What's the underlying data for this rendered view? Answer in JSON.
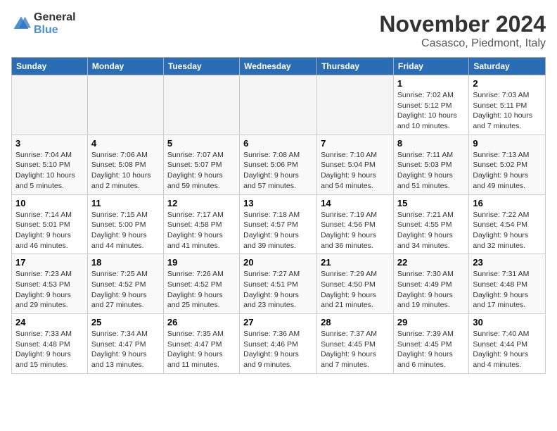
{
  "logo": {
    "text_general": "General",
    "text_blue": "Blue"
  },
  "header": {
    "month": "November 2024",
    "location": "Casasco, Piedmont, Italy"
  },
  "weekdays": [
    "Sunday",
    "Monday",
    "Tuesday",
    "Wednesday",
    "Thursday",
    "Friday",
    "Saturday"
  ],
  "weeks": [
    [
      {
        "day": "",
        "info": ""
      },
      {
        "day": "",
        "info": ""
      },
      {
        "day": "",
        "info": ""
      },
      {
        "day": "",
        "info": ""
      },
      {
        "day": "",
        "info": ""
      },
      {
        "day": "1",
        "info": "Sunrise: 7:02 AM\nSunset: 5:12 PM\nDaylight: 10 hours and 10 minutes."
      },
      {
        "day": "2",
        "info": "Sunrise: 7:03 AM\nSunset: 5:11 PM\nDaylight: 10 hours and 7 minutes."
      }
    ],
    [
      {
        "day": "3",
        "info": "Sunrise: 7:04 AM\nSunset: 5:10 PM\nDaylight: 10 hours and 5 minutes."
      },
      {
        "day": "4",
        "info": "Sunrise: 7:06 AM\nSunset: 5:08 PM\nDaylight: 10 hours and 2 minutes."
      },
      {
        "day": "5",
        "info": "Sunrise: 7:07 AM\nSunset: 5:07 PM\nDaylight: 9 hours and 59 minutes."
      },
      {
        "day": "6",
        "info": "Sunrise: 7:08 AM\nSunset: 5:06 PM\nDaylight: 9 hours and 57 minutes."
      },
      {
        "day": "7",
        "info": "Sunrise: 7:10 AM\nSunset: 5:04 PM\nDaylight: 9 hours and 54 minutes."
      },
      {
        "day": "8",
        "info": "Sunrise: 7:11 AM\nSunset: 5:03 PM\nDaylight: 9 hours and 51 minutes."
      },
      {
        "day": "9",
        "info": "Sunrise: 7:13 AM\nSunset: 5:02 PM\nDaylight: 9 hours and 49 minutes."
      }
    ],
    [
      {
        "day": "10",
        "info": "Sunrise: 7:14 AM\nSunset: 5:01 PM\nDaylight: 9 hours and 46 minutes."
      },
      {
        "day": "11",
        "info": "Sunrise: 7:15 AM\nSunset: 5:00 PM\nDaylight: 9 hours and 44 minutes."
      },
      {
        "day": "12",
        "info": "Sunrise: 7:17 AM\nSunset: 4:58 PM\nDaylight: 9 hours and 41 minutes."
      },
      {
        "day": "13",
        "info": "Sunrise: 7:18 AM\nSunset: 4:57 PM\nDaylight: 9 hours and 39 minutes."
      },
      {
        "day": "14",
        "info": "Sunrise: 7:19 AM\nSunset: 4:56 PM\nDaylight: 9 hours and 36 minutes."
      },
      {
        "day": "15",
        "info": "Sunrise: 7:21 AM\nSunset: 4:55 PM\nDaylight: 9 hours and 34 minutes."
      },
      {
        "day": "16",
        "info": "Sunrise: 7:22 AM\nSunset: 4:54 PM\nDaylight: 9 hours and 32 minutes."
      }
    ],
    [
      {
        "day": "17",
        "info": "Sunrise: 7:23 AM\nSunset: 4:53 PM\nDaylight: 9 hours and 29 minutes."
      },
      {
        "day": "18",
        "info": "Sunrise: 7:25 AM\nSunset: 4:52 PM\nDaylight: 9 hours and 27 minutes."
      },
      {
        "day": "19",
        "info": "Sunrise: 7:26 AM\nSunset: 4:52 PM\nDaylight: 9 hours and 25 minutes."
      },
      {
        "day": "20",
        "info": "Sunrise: 7:27 AM\nSunset: 4:51 PM\nDaylight: 9 hours and 23 minutes."
      },
      {
        "day": "21",
        "info": "Sunrise: 7:29 AM\nSunset: 4:50 PM\nDaylight: 9 hours and 21 minutes."
      },
      {
        "day": "22",
        "info": "Sunrise: 7:30 AM\nSunset: 4:49 PM\nDaylight: 9 hours and 19 minutes."
      },
      {
        "day": "23",
        "info": "Sunrise: 7:31 AM\nSunset: 4:48 PM\nDaylight: 9 hours and 17 minutes."
      }
    ],
    [
      {
        "day": "24",
        "info": "Sunrise: 7:33 AM\nSunset: 4:48 PM\nDaylight: 9 hours and 15 minutes."
      },
      {
        "day": "25",
        "info": "Sunrise: 7:34 AM\nSunset: 4:47 PM\nDaylight: 9 hours and 13 minutes."
      },
      {
        "day": "26",
        "info": "Sunrise: 7:35 AM\nSunset: 4:47 PM\nDaylight: 9 hours and 11 minutes."
      },
      {
        "day": "27",
        "info": "Sunrise: 7:36 AM\nSunset: 4:46 PM\nDaylight: 9 hours and 9 minutes."
      },
      {
        "day": "28",
        "info": "Sunrise: 7:37 AM\nSunset: 4:45 PM\nDaylight: 9 hours and 7 minutes."
      },
      {
        "day": "29",
        "info": "Sunrise: 7:39 AM\nSunset: 4:45 PM\nDaylight: 9 hours and 6 minutes."
      },
      {
        "day": "30",
        "info": "Sunrise: 7:40 AM\nSunset: 4:44 PM\nDaylight: 9 hours and 4 minutes."
      }
    ]
  ]
}
